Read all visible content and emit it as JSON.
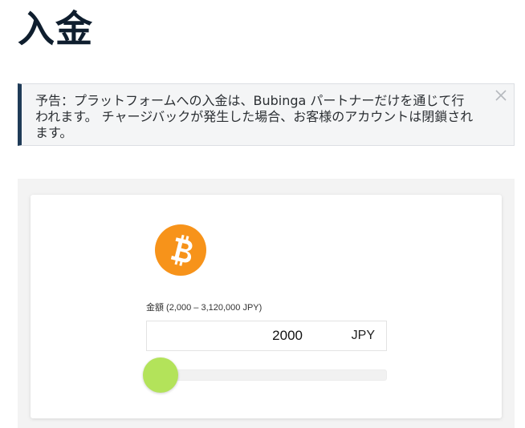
{
  "page": {
    "title": "入金"
  },
  "notice": {
    "text": "予告：プラットフォームへの入金は、Bubinga パートナーだけを通じて行われます。 チャージバックが発生した場合、お客様のアカウントは閉鎖されます。",
    "close_icon": "close-icon"
  },
  "payment": {
    "method_icon": "bitcoin-icon",
    "brand_color": "#f7931a",
    "amount_label": "金額 (2,000 – 3,120,000 JPY)",
    "amount_value": "2000",
    "currency": "JPY",
    "min": 2000,
    "max": 3120000,
    "slider_fraction": 0,
    "slider_color": "#b3e35a"
  }
}
